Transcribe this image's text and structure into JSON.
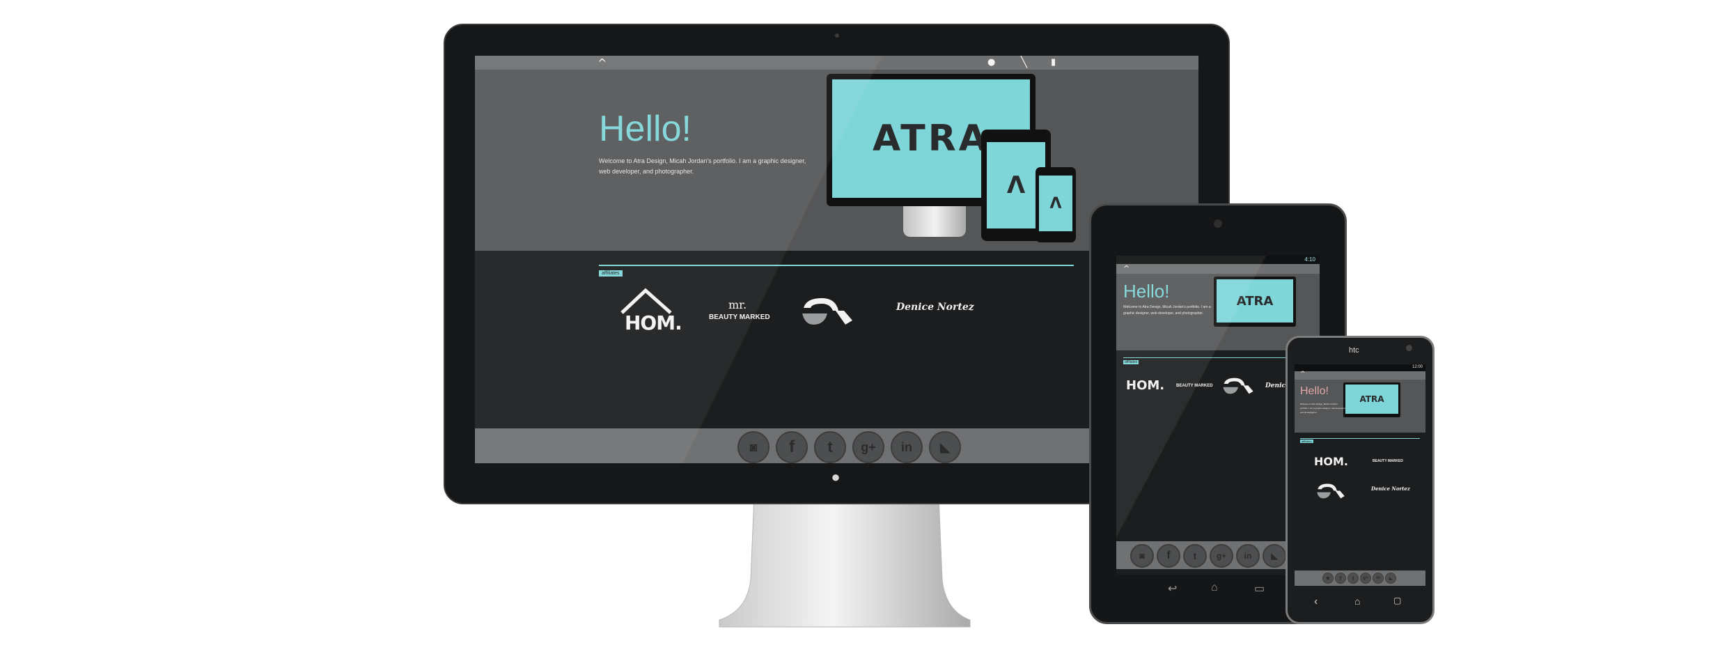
{
  "colors": {
    "accent": "#7ed6d8",
    "bezel": "#121314",
    "screen_bg": "#5b5c5d",
    "affiliates_bg": "#1b1d1e"
  },
  "site": {
    "nav": {
      "logo_icon": "caret-up-logo-icon",
      "user_icon": "user-icon",
      "pen_icon": "pen-icon",
      "doc_icon": "document-icon"
    },
    "hero": {
      "title": "Hello!",
      "intro": "Welcome to Atra Design, Micah Jordan's portfolio. I am a graphic designer, web developer, and photographer.",
      "brand": "ATRA",
      "brand_mark": "Λ"
    },
    "affiliates": {
      "tag": "affiliates",
      "logos": [
        "HOM.",
        "BEAUTY MARKED",
        "Denice Nortez"
      ],
      "beauty_small": "mr."
    },
    "social": [
      "instagram-icon",
      "facebook-icon",
      "twitter-icon",
      "google-plus-icon",
      "linkedin-icon",
      "vimeo-icon"
    ],
    "social_glyphs": [
      "◙",
      "f",
      "t",
      "g+",
      "in",
      "◣"
    ]
  },
  "tablet": {
    "status": "4:10",
    "nav_buttons": [
      "back-icon",
      "home-icon",
      "recents-icon"
    ]
  },
  "phone": {
    "brand": "htc",
    "status": "12:00",
    "nav_buttons": [
      "back-icon",
      "home-icon",
      "recents-icon"
    ],
    "nav_glyphs": [
      "‹",
      "⌂",
      "▢"
    ]
  },
  "monitor": {
    "apple_glyph": "●"
  }
}
